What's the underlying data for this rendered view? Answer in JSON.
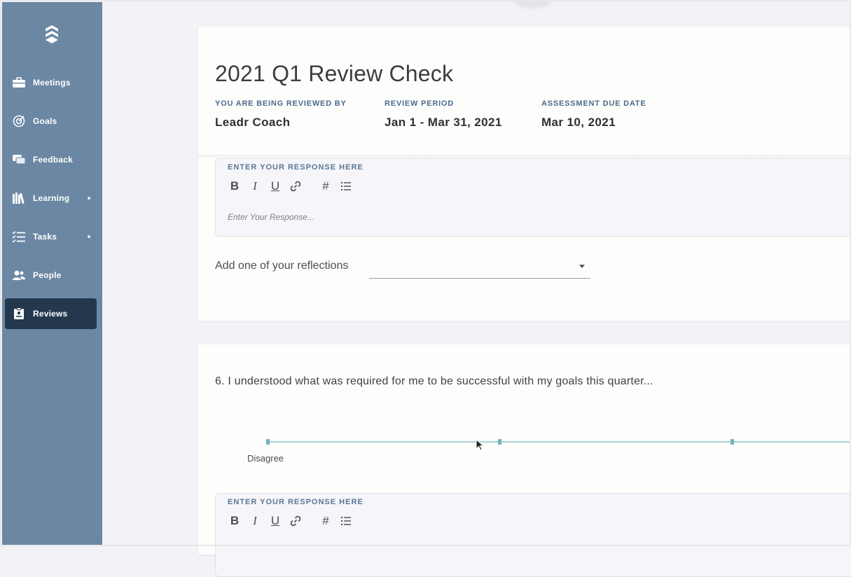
{
  "sidebar": {
    "items": [
      {
        "label": "Meetings",
        "icon": "briefcase-icon"
      },
      {
        "label": "Goals",
        "icon": "target-icon"
      },
      {
        "label": "Feedback",
        "icon": "feedback-icon"
      },
      {
        "label": "Learning",
        "icon": "books-icon"
      },
      {
        "label": "Tasks",
        "icon": "checklist-icon"
      },
      {
        "label": "People",
        "icon": "people-icon"
      },
      {
        "label": "Reviews",
        "icon": "reviews-icon"
      }
    ],
    "active": "Reviews",
    "colors": {
      "background": "#6b87a3",
      "active": "#24384d"
    }
  },
  "review": {
    "title": "2021 Q1 Review Check",
    "reviewer_label": "YOU ARE BEING REVIEWED BY",
    "reviewer_value": "Leadr Coach",
    "period_label": "REVIEW PERIOD",
    "period_value": "Jan 1 - Mar 31, 2021",
    "due_label": "ASSESSMENT DUE DATE",
    "due_value": "Mar 10, 2021"
  },
  "response1": {
    "label": "ENTER YOUR RESPONSE HERE",
    "placeholder": "Enter Your Response...",
    "toolbar": [
      "bold-icon",
      "italic-icon",
      "underline-icon",
      "link-icon",
      "hashtag-icon",
      "list-icon"
    ]
  },
  "reflection": {
    "label": "Add one of your reflections",
    "selected": ""
  },
  "question6": {
    "text": "6.  I understood what was required for me to be successful with my goals this quarter...",
    "scale_min_label": "Disagree"
  },
  "response2": {
    "label": "ENTER YOUR RESPONSE HERE"
  }
}
